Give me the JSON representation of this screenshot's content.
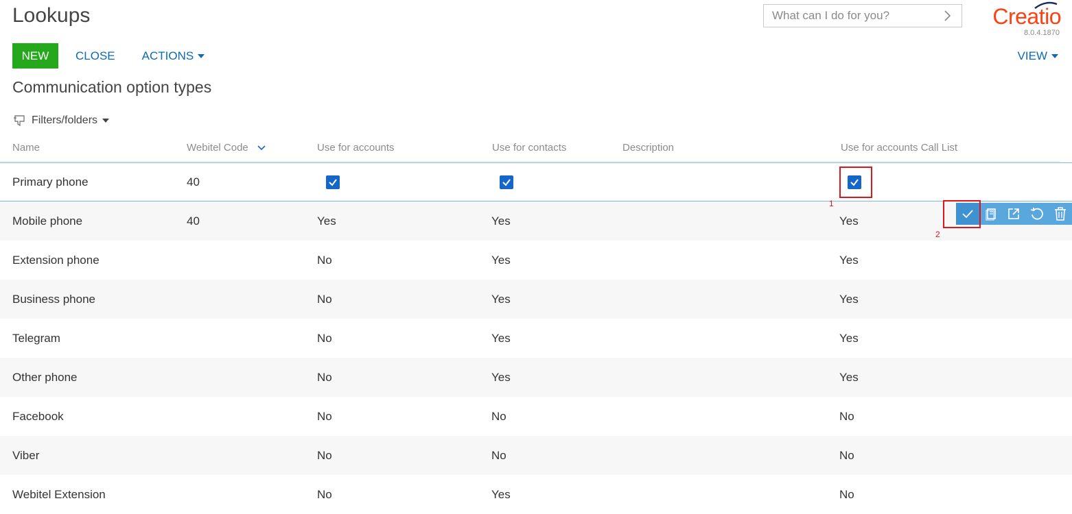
{
  "header": {
    "title": "Lookups",
    "search_placeholder": "What can I do for you?",
    "brand": "Creatio",
    "version": "8.0.4.1870",
    "brand_color": "#ff4013"
  },
  "toolbar": {
    "new_label": "NEW",
    "close_label": "CLOSE",
    "actions_label": "ACTIONS",
    "view_label": "VIEW"
  },
  "section_title": "Communication option types",
  "filters_label": "Filters/folders",
  "columns": {
    "name": "Name",
    "webitel_code": "Webitel Code",
    "use_for_accounts": "Use for accounts",
    "use_for_contacts": "Use for contacts",
    "description": "Description",
    "use_for_accounts_call_list": "Use for accounts Call List"
  },
  "editing_row": {
    "name": "Primary phone",
    "webitel_code": "40",
    "use_for_accounts": true,
    "use_for_contacts": true,
    "use_for_accounts_call_list": true
  },
  "rows": [
    {
      "name": "Mobile phone",
      "webitel_code": "40",
      "accounts": "Yes",
      "contacts": "Yes",
      "call_list": "Yes"
    },
    {
      "name": "Extension phone",
      "webitel_code": "",
      "accounts": "No",
      "contacts": "Yes",
      "call_list": "Yes"
    },
    {
      "name": "Business phone",
      "webitel_code": "",
      "accounts": "No",
      "contacts": "Yes",
      "call_list": "Yes"
    },
    {
      "name": "Telegram",
      "webitel_code": "",
      "accounts": "No",
      "contacts": "Yes",
      "call_list": "Yes"
    },
    {
      "name": "Other phone",
      "webitel_code": "",
      "accounts": "No",
      "contacts": "Yes",
      "call_list": "Yes"
    },
    {
      "name": "Facebook",
      "webitel_code": "",
      "accounts": "No",
      "contacts": "No",
      "call_list": "No"
    },
    {
      "name": "Viber",
      "webitel_code": "",
      "accounts": "No",
      "contacts": "No",
      "call_list": "No"
    },
    {
      "name": "Webitel Extension",
      "webitel_code": "",
      "accounts": "No",
      "contacts": "Yes",
      "call_list": "No"
    }
  ],
  "annotations": {
    "label_1": "1",
    "label_2": "2"
  },
  "row_actions": [
    "save-icon",
    "copy-icon",
    "open-icon",
    "undo-icon",
    "delete-icon"
  ]
}
